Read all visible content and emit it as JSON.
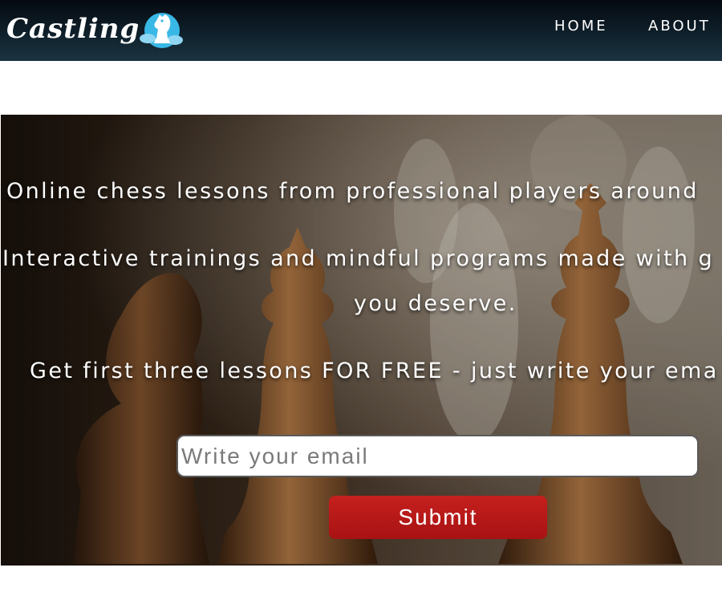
{
  "nav": {
    "logo_text": "Castling",
    "items": [
      {
        "label": "HOME"
      },
      {
        "label": "ABOUT"
      }
    ]
  },
  "hero": {
    "line1": "Online chess lessons from professional players around",
    "line2": "Interactive trainings and mindful programs made with g",
    "line3": "you deserve.",
    "line4": "Get first three lessons FOR FREE - just write your ema",
    "email_placeholder": "Write your email",
    "submit_label": "Submit"
  },
  "colors": {
    "navbar": "#0f202b",
    "submit": "#b31818",
    "logo_badge": "#39b8e6"
  },
  "icons": {
    "logo": "knight-icon"
  }
}
